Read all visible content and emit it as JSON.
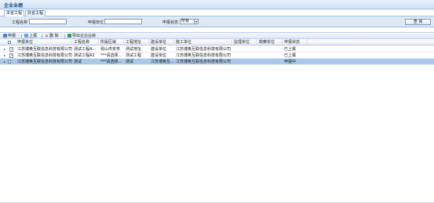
{
  "window": {
    "title": "企业业绩"
  },
  "tabs": [
    {
      "label": "本省工程",
      "active": true
    },
    {
      "label": "外省工程",
      "active": false
    }
  ],
  "filter": {
    "project_name_label": "工程名称",
    "project_name_value": "",
    "report_unit_label": "申报单位",
    "report_unit_value": "",
    "report_status_label": "申报状态",
    "report_status_value": "所有",
    "query_button": "查 询"
  },
  "toolbar": {
    "report": "申报",
    "report_up": "上报",
    "delete": "删 除",
    "export": "导出企业业绩"
  },
  "grid": {
    "columns": [
      "申报单位",
      "工程名称",
      "所属区域",
      "工程地址",
      "建设单位",
      "施工单位",
      "监理单位",
      "勘察单位",
      "申报状态"
    ],
    "rows": [
      [
        "江苏博奥互联信息科技有限公司",
        "测试工程A…",
        "昆山市安亭",
        "测试地址",
        "建设单位",
        "江苏博奥互联信息科技有限公司",
        "",
        "",
        "已上报"
      ],
      [
        "江苏博奥互联信息科技有限公司",
        "测试工程A2",
        "***请选择…",
        "测试工程",
        "建设单位",
        "江苏博奥互联信息科技有限公司",
        "",
        "",
        "已上报"
      ],
      [
        "江苏博奥互联信息科技有限公司",
        "测试",
        "***请选择…",
        "测试",
        "江苏博奥互…",
        "江苏博奥互联信息科技有限公司",
        "",
        "",
        "申报中"
      ]
    ]
  },
  "colors": {
    "selected_row": "#a9c8ec",
    "header_bg": "#dfe9f6",
    "title_text": "#1f4e8c"
  }
}
